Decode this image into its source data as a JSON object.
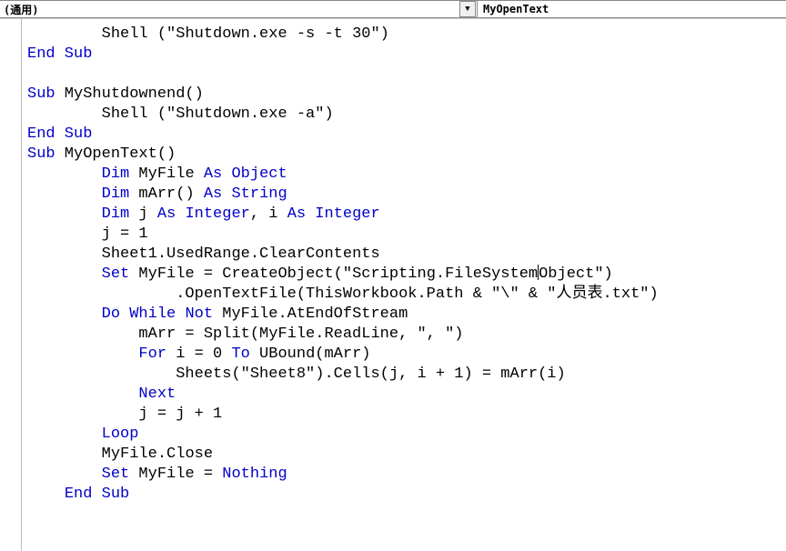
{
  "topbar": {
    "left_label": "(通用)",
    "right_label": "MyOpenText"
  },
  "code": {
    "lines": [
      {
        "indent": "        ",
        "segs": [
          {
            "c": "txt",
            "t": "Shell (\"Shutdown.exe -s -t 30\")"
          }
        ]
      },
      {
        "indent": "",
        "segs": [
          {
            "c": "kw",
            "t": "End Sub"
          }
        ]
      },
      {
        "indent": "",
        "segs": []
      },
      {
        "indent": "",
        "segs": [
          {
            "c": "kw",
            "t": "Sub"
          },
          {
            "c": "txt",
            "t": " MyShutdownend()"
          }
        ]
      },
      {
        "indent": "        ",
        "segs": [
          {
            "c": "txt",
            "t": "Shell (\"Shutdown.exe -a\")"
          }
        ]
      },
      {
        "indent": "",
        "segs": [
          {
            "c": "kw",
            "t": "End Sub"
          }
        ]
      },
      {
        "indent": "",
        "segs": [
          {
            "c": "kw",
            "t": "Sub"
          },
          {
            "c": "txt",
            "t": " MyOpenText()"
          }
        ]
      },
      {
        "indent": "        ",
        "segs": [
          {
            "c": "kw",
            "t": "Dim"
          },
          {
            "c": "txt",
            "t": " MyFile "
          },
          {
            "c": "kw",
            "t": "As Object"
          }
        ]
      },
      {
        "indent": "        ",
        "segs": [
          {
            "c": "kw",
            "t": "Dim"
          },
          {
            "c": "txt",
            "t": " mArr() "
          },
          {
            "c": "kw",
            "t": "As String"
          }
        ]
      },
      {
        "indent": "        ",
        "segs": [
          {
            "c": "kw",
            "t": "Dim"
          },
          {
            "c": "txt",
            "t": " j "
          },
          {
            "c": "kw",
            "t": "As Integer"
          },
          {
            "c": "txt",
            "t": ", i "
          },
          {
            "c": "kw",
            "t": "As Integer"
          }
        ]
      },
      {
        "indent": "        ",
        "segs": [
          {
            "c": "txt",
            "t": "j = 1"
          }
        ]
      },
      {
        "indent": "        ",
        "segs": [
          {
            "c": "txt",
            "t": "Sheet1.UsedRange.ClearContents"
          }
        ]
      },
      {
        "indent": "        ",
        "segs": [
          {
            "c": "kw",
            "t": "Set"
          },
          {
            "c": "txt",
            "t": " MyFile = CreateObject(\"Scripting.FileSystem"
          },
          {
            "cursor": true
          },
          {
            "c": "txt",
            "t": "Object\")"
          }
        ]
      },
      {
        "indent": "                ",
        "segs": [
          {
            "c": "txt",
            "t": ".OpenTextFile(ThisWorkbook.Path & \"\\\" & \"人员表.txt\")"
          }
        ]
      },
      {
        "indent": "        ",
        "segs": [
          {
            "c": "kw",
            "t": "Do While Not"
          },
          {
            "c": "txt",
            "t": " MyFile.AtEndOfStream"
          }
        ]
      },
      {
        "indent": "            ",
        "segs": [
          {
            "c": "txt",
            "t": "mArr = Split(MyFile.ReadLine, \", \")"
          }
        ]
      },
      {
        "indent": "            ",
        "segs": [
          {
            "c": "kw",
            "t": "For"
          },
          {
            "c": "txt",
            "t": " i = 0 "
          },
          {
            "c": "kw",
            "t": "To"
          },
          {
            "c": "txt",
            "t": " UBound(mArr)"
          }
        ]
      },
      {
        "indent": "                ",
        "segs": [
          {
            "c": "txt",
            "t": "Sheets(\"Sheet8\").Cells(j, i + 1) = mArr(i)"
          }
        ]
      },
      {
        "indent": "            ",
        "segs": [
          {
            "c": "kw",
            "t": "Next"
          }
        ]
      },
      {
        "indent": "            ",
        "segs": [
          {
            "c": "txt",
            "t": "j = j + 1"
          }
        ]
      },
      {
        "indent": "        ",
        "segs": [
          {
            "c": "kw",
            "t": "Loop"
          }
        ]
      },
      {
        "indent": "        ",
        "segs": [
          {
            "c": "txt",
            "t": "MyFile.Close"
          }
        ]
      },
      {
        "indent": "        ",
        "segs": [
          {
            "c": "kw",
            "t": "Set"
          },
          {
            "c": "txt",
            "t": " MyFile = "
          },
          {
            "c": "kw",
            "t": "Nothing"
          }
        ]
      },
      {
        "indent": "    ",
        "segs": [
          {
            "c": "kw",
            "t": "End Sub"
          }
        ]
      }
    ]
  }
}
